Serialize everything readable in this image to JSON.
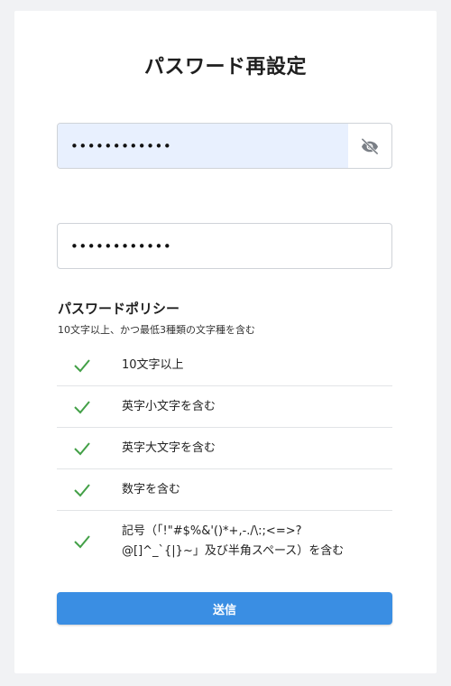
{
  "page": {
    "title": "パスワード再設定"
  },
  "form": {
    "new_password_value": "••••••••••••",
    "confirm_password_value": "••••••••••••",
    "visibility_icon": "eye-off-icon"
  },
  "policy": {
    "title": "パスワードポリシー",
    "subtitle": "10文字以上、かつ最低3種類の文字種を含む",
    "check_icon": "check-icon",
    "check_color": "#43a047",
    "rules": [
      {
        "label": "10文字以上",
        "satisfied": true
      },
      {
        "label": "英字小文字を含む",
        "satisfied": true
      },
      {
        "label": "英字大文字を含む",
        "satisfied": true
      },
      {
        "label": "数字を含む",
        "satisfied": true
      },
      {
        "label": "記号（「!\"#$%&'()*+,-./\\:;<=>?@[]^_`{|}~」及び半角スペース）を含む",
        "satisfied": true
      }
    ]
  },
  "actions": {
    "submit_label": "送信",
    "submit_color": "#3a8ee3"
  }
}
